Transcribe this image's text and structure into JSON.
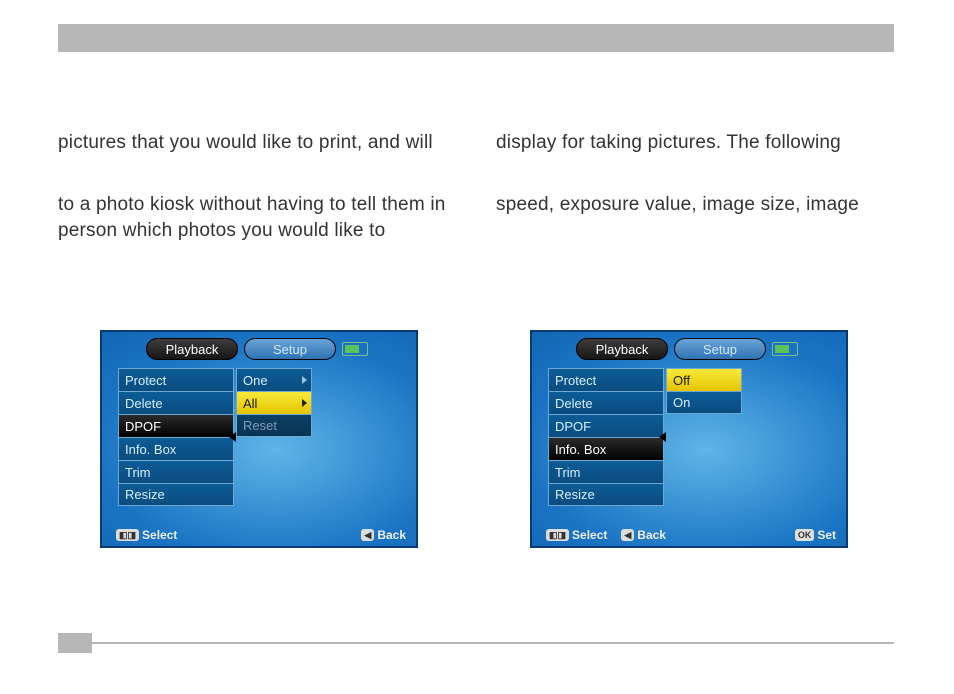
{
  "text": {
    "left_para_1": "pictures that you would like to print, and will",
    "left_para_2": "to a photo kiosk without having to tell them in person which photos you would like to",
    "right_para_1": "display for taking pictures. The following",
    "right_para_2": "speed, exposure value, image size, image"
  },
  "tabs": {
    "playback": "Playback",
    "setup": "Setup"
  },
  "menu_items": [
    "Protect",
    "Delete",
    "DPOF",
    "Info. Box",
    "Trim",
    "Resize"
  ],
  "left_menu": {
    "selected": "DPOF",
    "sub": [
      "One",
      "All",
      "Reset"
    ],
    "sub_highlight": "All",
    "sub_dimmed": [
      "Reset"
    ],
    "footer": {
      "select": "Select",
      "back": "Back"
    }
  },
  "right_menu": {
    "selected": "Info. Box",
    "sub": [
      "Off",
      "On"
    ],
    "sub_highlight": "Off",
    "sub_dimmed": [],
    "footer": {
      "select": "Select",
      "back": "Back",
      "set": "Set"
    }
  }
}
